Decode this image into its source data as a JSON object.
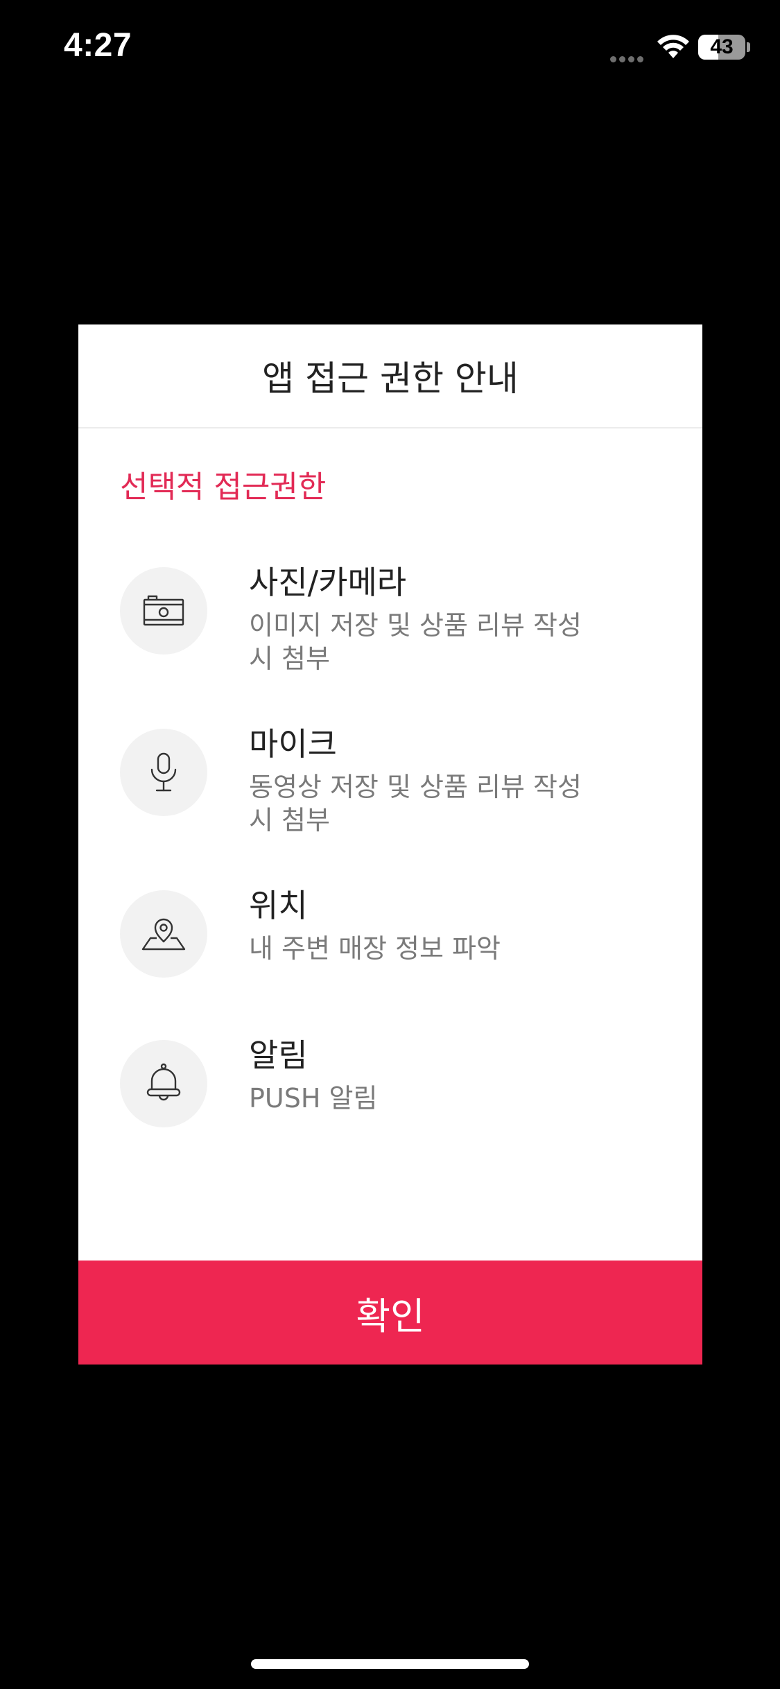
{
  "status_bar": {
    "time": "4:27",
    "battery_level": "43",
    "battery_fraction": 0.43
  },
  "dialog": {
    "title": "앱 접근 권한 안내",
    "section_title": "선택적 접근권한",
    "permissions": [
      {
        "icon": "camera-icon",
        "name": "사진/카메라",
        "description": "이미지 저장 및 상품 리뷰 작성 시 첨부"
      },
      {
        "icon": "microphone-icon",
        "name": "마이크",
        "description": "동영상 저장 및 상품 리뷰 작성 시 첨부"
      },
      {
        "icon": "location-icon",
        "name": "위치",
        "description": "내 주변 매장 정보 파악"
      },
      {
        "icon": "bell-icon",
        "name": "알림",
        "description": "PUSH 알림"
      }
    ],
    "confirm_label": "확인"
  },
  "colors": {
    "accent": "#ee2651",
    "section_title": "#e22a55",
    "icon_circle_bg": "#f2f2f2",
    "overlay": "#000000"
  }
}
